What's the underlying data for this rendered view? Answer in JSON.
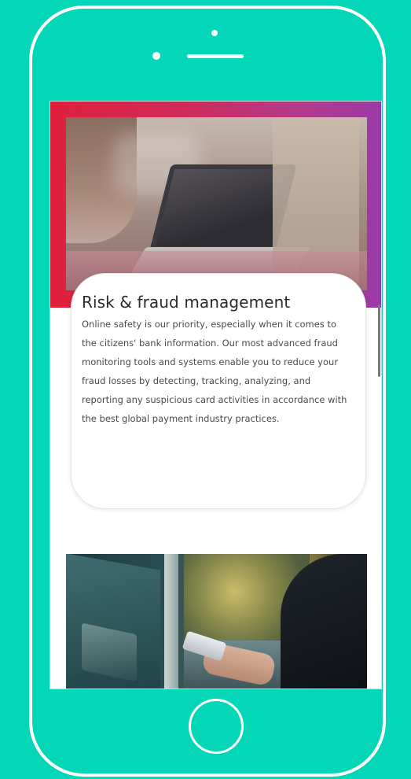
{
  "colors": {
    "background": "#04d6b8",
    "phone_outline": "#ffffff",
    "gradient_start": "#e0203a",
    "gradient_end": "#9a3aa8",
    "title_text": "#2a2a2a",
    "body_text": "#4a4a4a"
  },
  "icons": {
    "camera": "camera-dot-icon",
    "speaker": "speaker-icon",
    "home_button": "home-button-icon"
  },
  "cards": [
    {
      "title": "Risk & fraud management",
      "body": "Online safety is our priority, especially when it comes to the citizens' bank information. Our most advanced fraud monitoring tools and systems enable you to reduce your fraud losses by detecting, tracking, analyzing, and reporting any suspicious card activities in accordance with the best global payment industry practices."
    }
  ]
}
